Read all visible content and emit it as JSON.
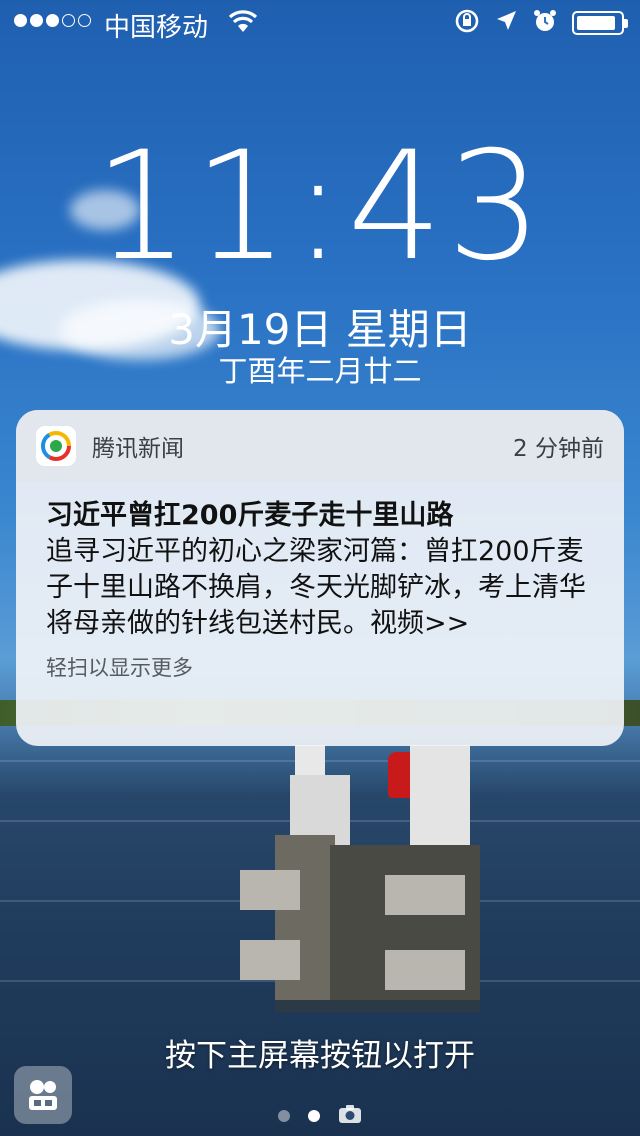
{
  "status_bar": {
    "signal_strength": "3 of 5",
    "carrier": "中国移动",
    "wifi_icon": "wifi-icon",
    "icons": [
      "rotation-lock-icon",
      "location-arrow-icon",
      "alarm-icon",
      "battery-icon"
    ],
    "battery_level": 0.9
  },
  "lock_screen": {
    "time": "11:43",
    "date": "3月19日 星期日",
    "lunar_date": "丁酉年二月廿二"
  },
  "notification": {
    "app_name": "腾讯新闻",
    "time_ago": "2 分钟前",
    "title": "习近平曾扛200斤麦子走十里山路",
    "body": "追寻习近平的初心之梁家河篇：曾扛200斤麦子十里山路不换肩，冬天光脚铲冰，考上清华将母亲做的针线包送村民。视频>>",
    "hint": "轻扫以显示更多"
  },
  "bottom": {
    "unlock_hint": "按下主屏幕按钮以打开",
    "page_count": 2,
    "active_page": 2,
    "camera_icon": "camera-icon"
  }
}
